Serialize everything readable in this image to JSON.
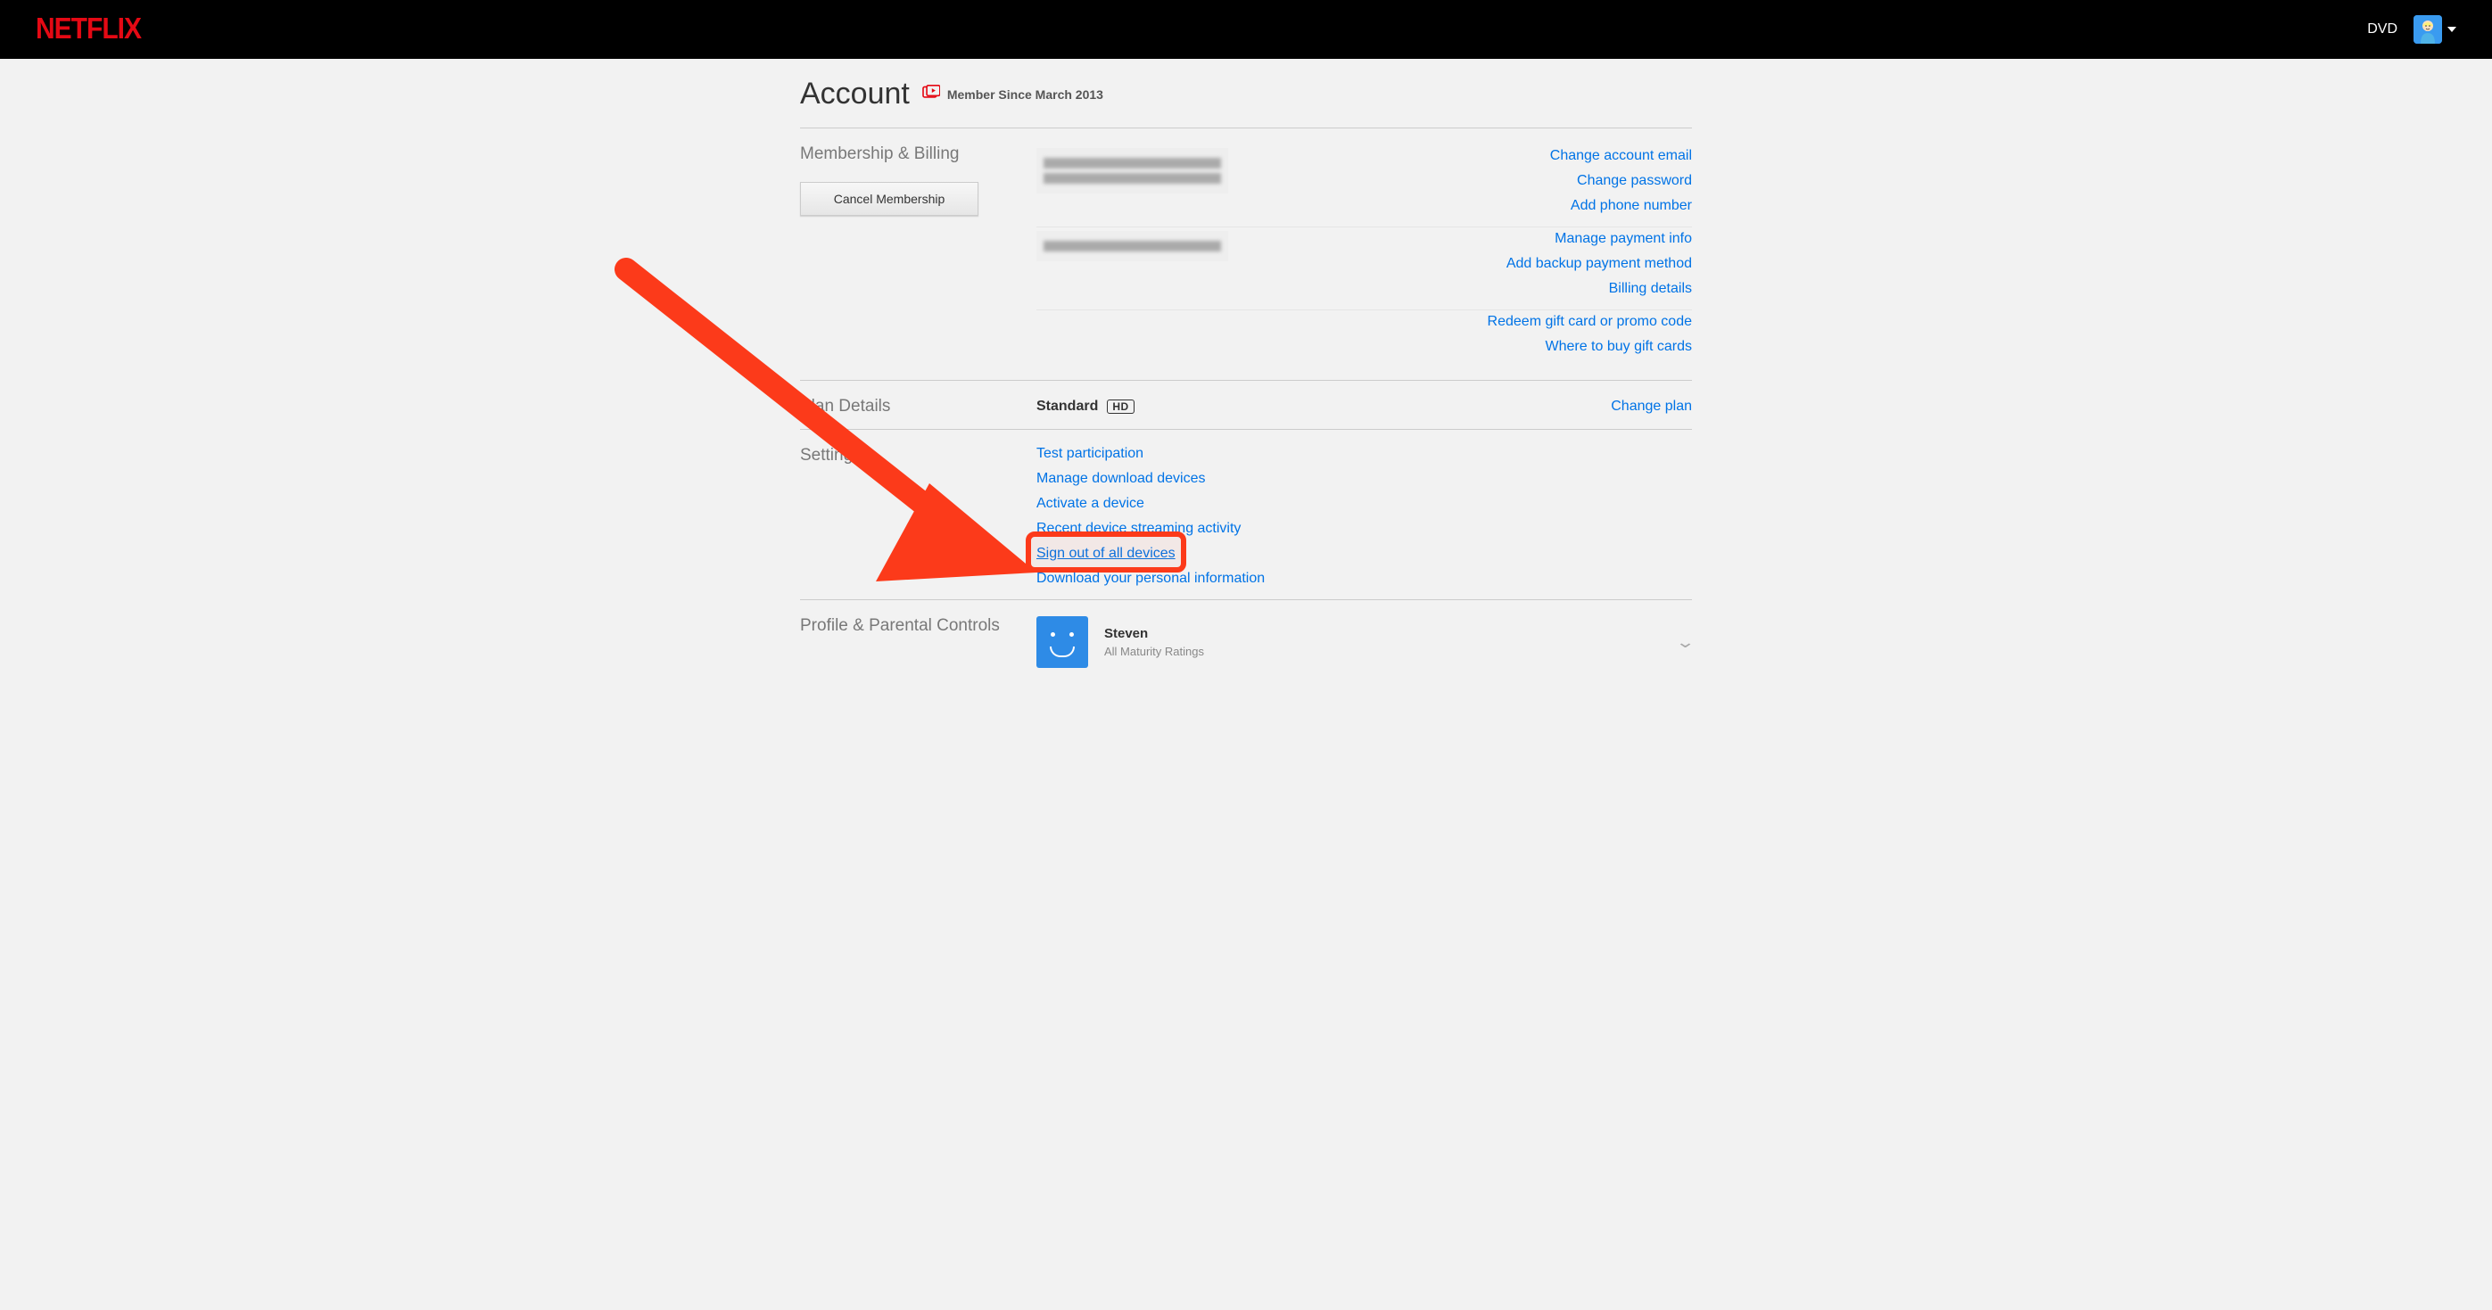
{
  "header": {
    "logo_text": "NETFLIX",
    "dvd_link": "DVD"
  },
  "page": {
    "title": "Account",
    "member_since": "Member Since March 2013"
  },
  "membership": {
    "label": "Membership & Billing",
    "cancel_button": "Cancel Membership",
    "account_links": {
      "change_email": "Change account email",
      "change_password": "Change password",
      "add_phone": "Add phone number"
    },
    "payment_links": {
      "manage_payment": "Manage payment info",
      "add_backup": "Add backup payment method",
      "billing_details": "Billing details"
    },
    "gift_links": {
      "redeem": "Redeem gift card or promo code",
      "where_to_buy": "Where to buy gift cards"
    }
  },
  "plan": {
    "label": "Plan Details",
    "name": "Standard",
    "badge": "HD",
    "change_link": "Change plan"
  },
  "settings": {
    "label": "Settings",
    "links": {
      "test": "Test participation",
      "manage_downloads": "Manage download devices",
      "activate": "Activate a device",
      "recent_activity": "Recent device streaming activity",
      "sign_out_all": "Sign out of all devices",
      "download_info": "Download your personal information"
    }
  },
  "profile": {
    "label": "Profile & Parental Controls",
    "name": "Steven",
    "maturity": "All Maturity Ratings"
  }
}
